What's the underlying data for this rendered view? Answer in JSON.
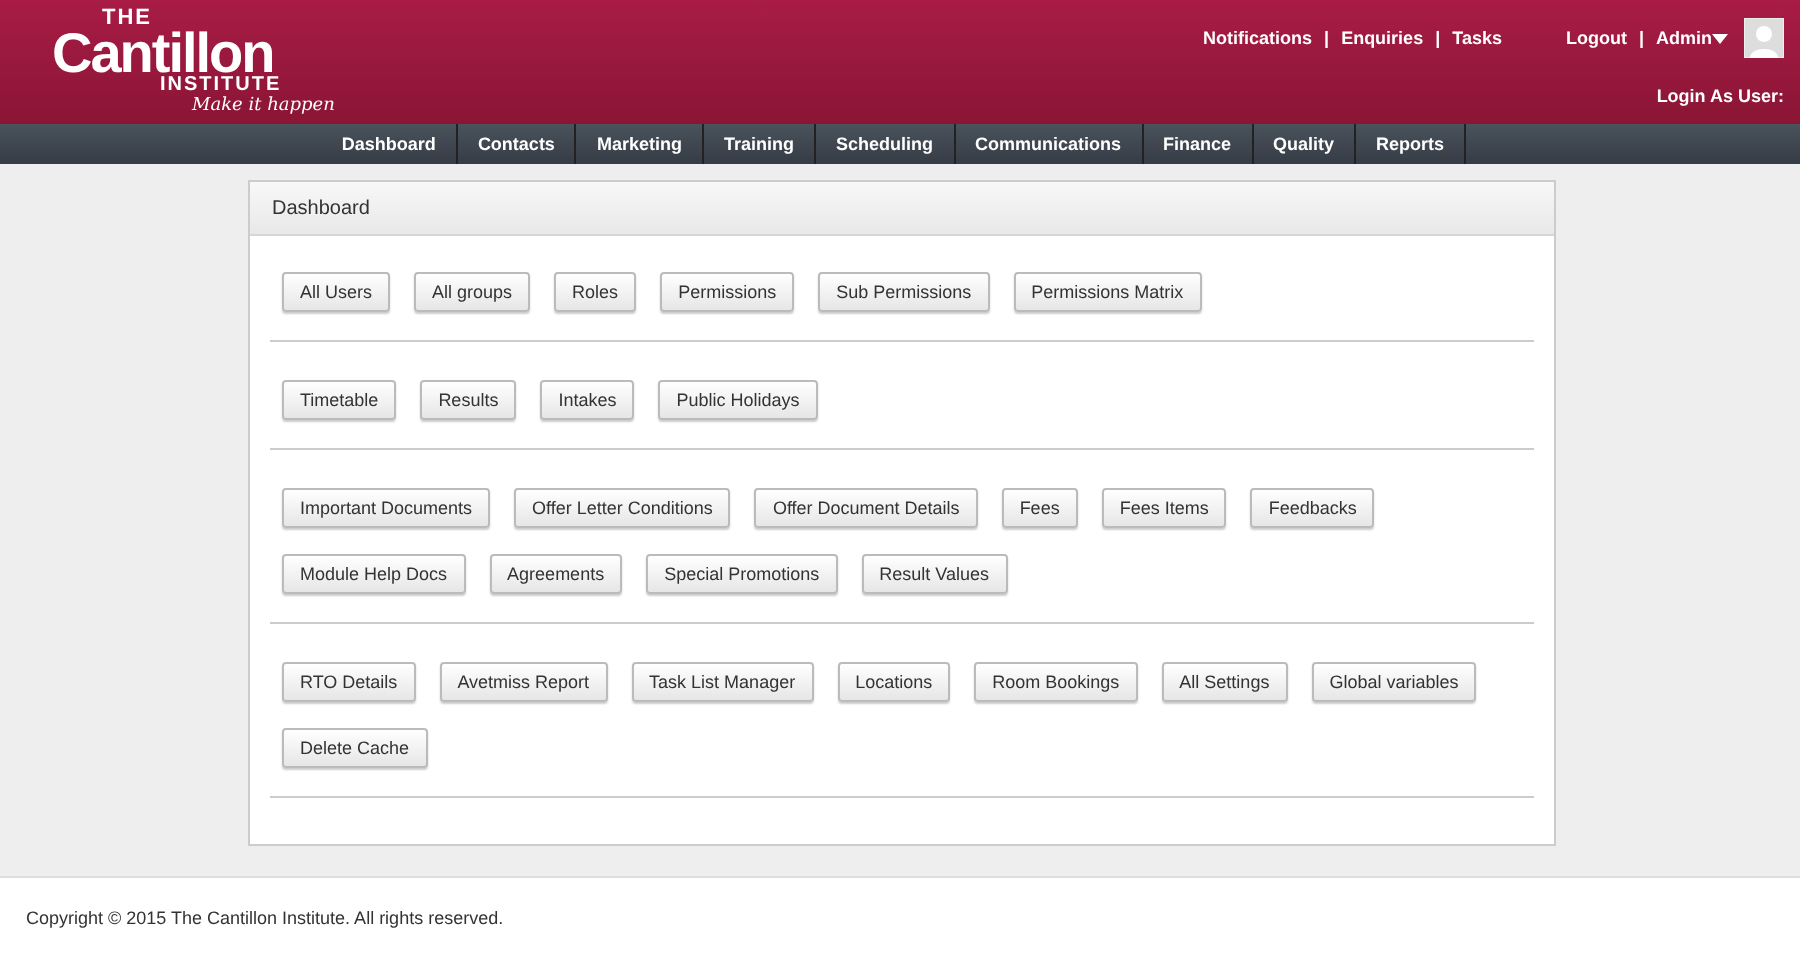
{
  "logo": {
    "top": "THE",
    "main": "Cantillon",
    "sub": "INSTITUTE",
    "tagline": "Make it happen"
  },
  "top_links": [
    "Notifications",
    "Enquiries",
    "Tasks"
  ],
  "link_separator": "|",
  "user_links": {
    "logout": "Logout",
    "separator": "|",
    "admin": "Admin"
  },
  "login_as": "Login As User:",
  "nav": [
    "Dashboard",
    "Contacts",
    "Marketing",
    "Training",
    "Scheduling",
    "Communications",
    "Finance",
    "Quality",
    "Reports"
  ],
  "panel": {
    "title": "Dashboard",
    "sections": [
      [
        "All Users",
        "All groups",
        "Roles",
        "Permissions",
        "Sub Permissions",
        "Permissions Matrix"
      ],
      [
        "Timetable",
        "Results",
        "Intakes",
        "Public Holidays"
      ],
      [
        "Important Documents",
        "Offer Letter Conditions",
        "Offer Document Details",
        "Fees",
        "Fees Items",
        "Feedbacks",
        "Module Help Docs",
        "Agreements",
        "Special Promotions",
        "Result Values"
      ],
      [
        "RTO Details",
        "Avetmiss Report",
        "Task List Manager",
        "Locations",
        "Room Bookings",
        "All Settings",
        "Global variables",
        "Delete Cache"
      ]
    ]
  },
  "footer": "Copyright © 2015 The Cantillon Institute. All rights reserved."
}
